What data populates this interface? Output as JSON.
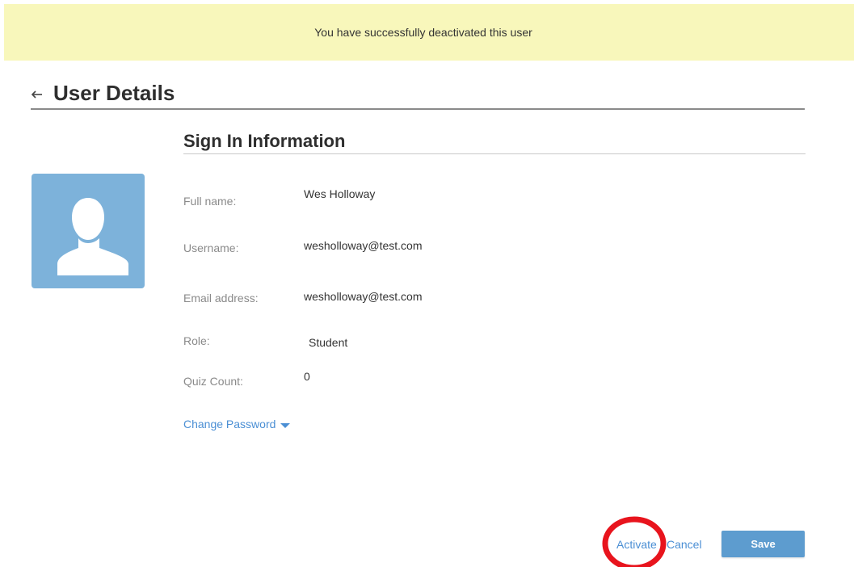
{
  "banner": {
    "message": "You have successfully deactivated this user"
  },
  "header": {
    "title": "User Details",
    "back_icon": "back-arrow-icon"
  },
  "avatar": {
    "icon": "user-silhouette-icon",
    "bg_color": "#7db2da"
  },
  "sign_in": {
    "title": "Sign In Information",
    "fields": [
      {
        "label": "Full name:",
        "value": "Wes Holloway"
      },
      {
        "label": "Username:",
        "value": "wesholloway@test.com"
      },
      {
        "label": "Email address:",
        "value": "wesholloway@test.com"
      },
      {
        "label": "Role:",
        "value": "Student"
      },
      {
        "label": "Quiz Count:",
        "value": "0"
      }
    ],
    "change_password": "Change Password"
  },
  "actions": {
    "activate": "Activate",
    "cancel": "Cancel",
    "save": "Save"
  },
  "colors": {
    "banner_bg": "#f8f7bb",
    "link": "#4b8fd4",
    "save_bg": "#5d9ccf",
    "highlight": "#e8141d"
  }
}
